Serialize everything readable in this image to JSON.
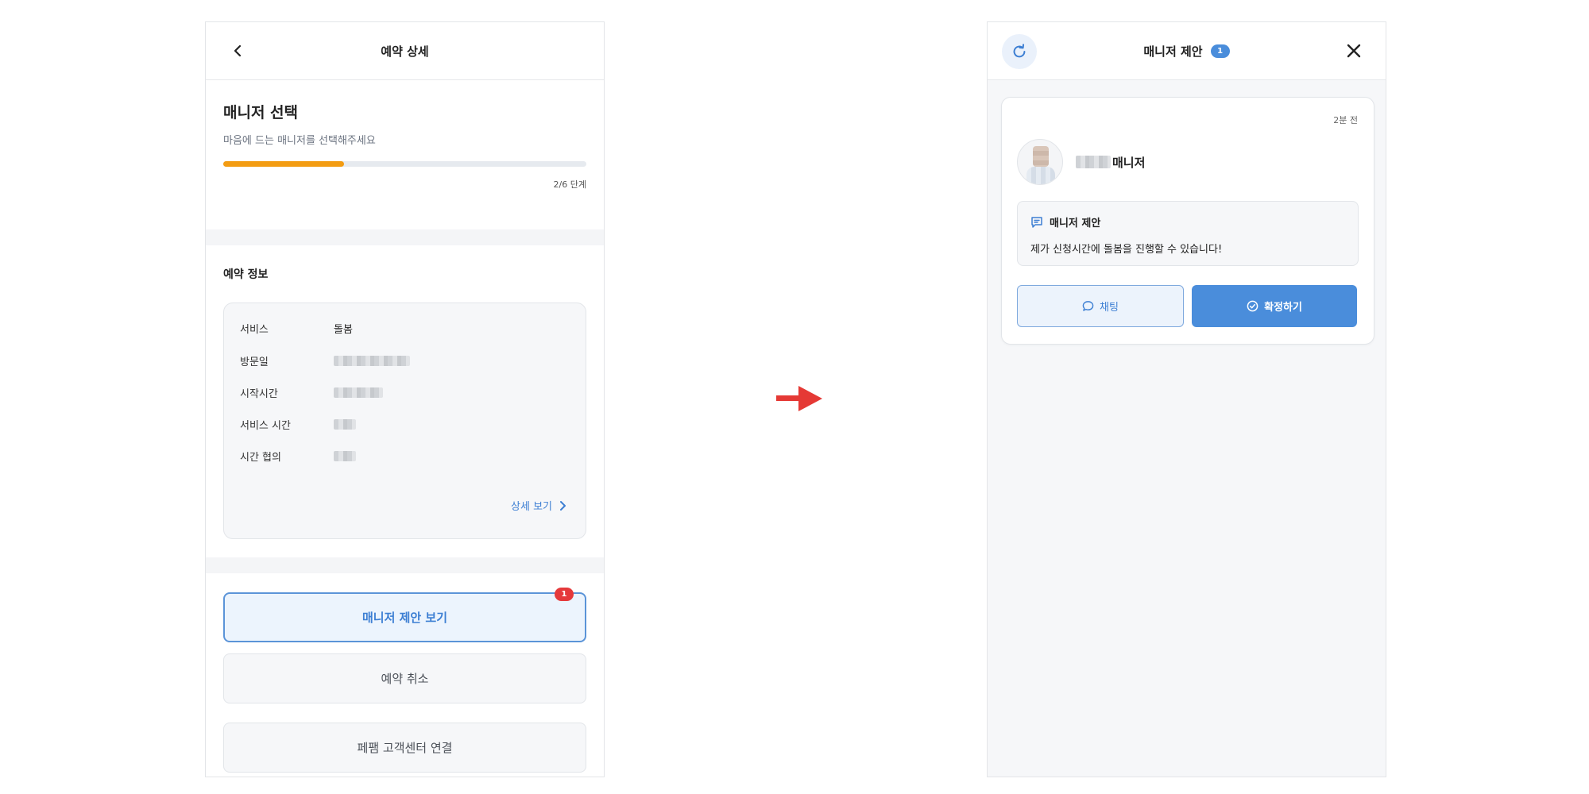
{
  "left_screen": {
    "header": {
      "title": "예약 상세"
    },
    "select_section": {
      "title": "매니저 선택",
      "subtitle": "마음에 드는 매니저를 선택해주세요",
      "progress": {
        "current": 2,
        "total": 6,
        "label": "2/6 단계"
      }
    },
    "info_section": {
      "title": "예약 정보",
      "rows": [
        {
          "label": "서비스",
          "value": "돌봄"
        },
        {
          "label": "방문일",
          "value": ""
        },
        {
          "label": "시작시간",
          "value": ""
        },
        {
          "label": "서비스 시간",
          "value": ""
        },
        {
          "label": "시간 협의",
          "value": ""
        }
      ],
      "detail_link": "상세 보기"
    },
    "actions": {
      "view_offers": "매니저 제안 보기",
      "offers_badge": "1",
      "cancel": "예약 취소",
      "support": "페팸 고객센터 연결"
    }
  },
  "right_screen": {
    "header": {
      "title": "매니저 제안",
      "count_badge": "1"
    },
    "offer": {
      "time_ago": "2분 전",
      "manager_suffix": "매니저",
      "message_title": "매니저 제안",
      "message_text": "제가 신청시간에 돌봄을 진행할 수 있습니다!",
      "chat_label": "채팅",
      "confirm_label": "확정하기"
    }
  },
  "colors": {
    "accent": "#4a8ddb",
    "progress": "#f39c12",
    "alert": "#e5393b",
    "arrow": "#e53935"
  }
}
